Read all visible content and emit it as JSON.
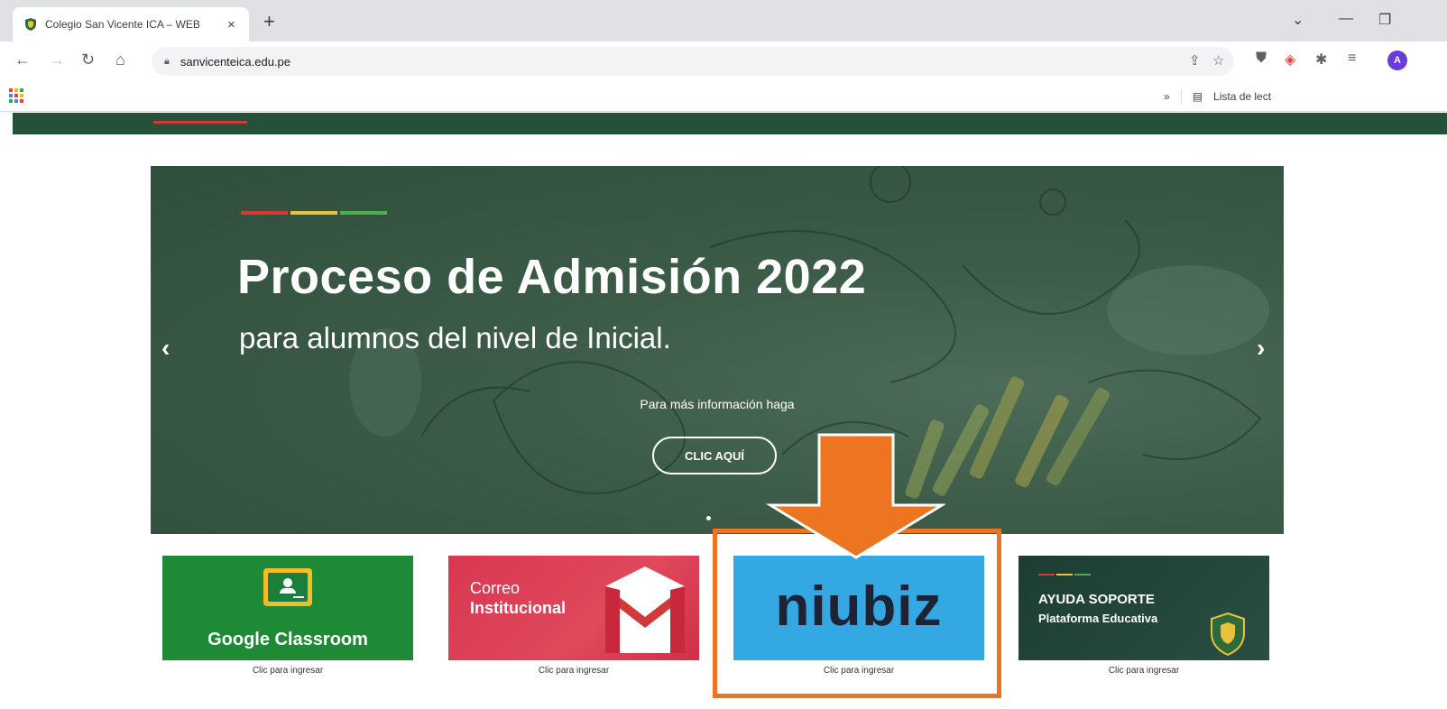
{
  "browser": {
    "tab": {
      "title": "Colegio San Vicente ICA – WEB",
      "close_icon": "×"
    },
    "new_tab_icon": "+",
    "url": "sanvicenteica.edu.pe",
    "profile_initial": "A",
    "bookmarks": {
      "overflow": "»",
      "reading_list": "Lista de lect"
    }
  },
  "colors": {
    "accent_green": "#25503a",
    "stripe_red": "#d33a32",
    "stripe_yellow": "#e7c23a",
    "stripe_green": "#4caf50",
    "highlight_orange": "#ed7420"
  },
  "hero": {
    "title": "Proceso de Admisión 2022",
    "subtitle": "para alumnos del nivel de Inicial.",
    "info": "Para más información haga",
    "button": "CLIC AQUÍ",
    "prev_arrow": "‹",
    "next_arrow": "›"
  },
  "cards": [
    {
      "title": "Google Classroom",
      "caption": "Clic para ingresar"
    },
    {
      "line1": "Correo",
      "line2": "Institucional",
      "caption": "Clic para ingresar"
    },
    {
      "logo": "niubiz",
      "caption": "Clic para ingresar"
    },
    {
      "line1": "AYUDA SOPORTE",
      "line2": "Plataforma Educativa",
      "caption": "Clic para ingresar"
    }
  ]
}
